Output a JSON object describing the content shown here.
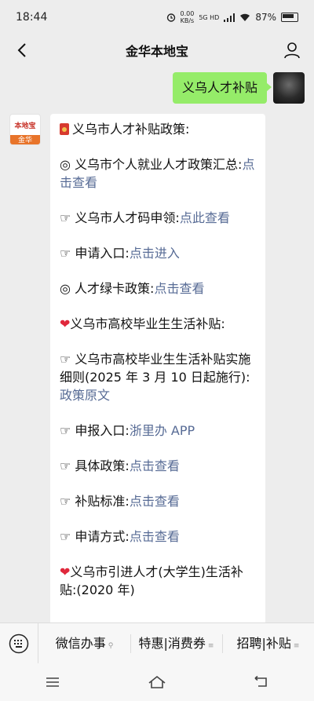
{
  "status_bar": {
    "time": "18:44",
    "net_speed_value": "0.00",
    "net_speed_unit": "KB/s",
    "network": "5G HD",
    "battery": "87%"
  },
  "nav": {
    "title": "金华本地宝"
  },
  "sent_message": {
    "text": "义乌人才补贴"
  },
  "bot": {
    "avatar_logo": "本地宝",
    "avatar_tag": "金华"
  },
  "received_message": {
    "title": "义乌市人才补贴政策:",
    "p1_text": "◎ 义乌市个人就业人才政策汇总:",
    "p1_link": "点击查看",
    "p2_text": "☞ 义乌市人才码申领:",
    "p2_link": "点此查看",
    "p3_text": "☞ 申请入口:",
    "p3_link": "点击进入",
    "p4_text": "◎ 人才绿卡政策:",
    "p4_link": "点击查看",
    "section2_title": "义乌市高校毕业生生活补贴:",
    "p5_text": "☞ 义乌市高校毕业生生活补贴实施细则(2025 年 3 月 10 日起施行):",
    "p5_link": "政策原文",
    "p6_text": "☞ 申报入口:",
    "p6_link": "浙里办 APP",
    "p7_text": "☞ 具体政策:",
    "p7_link": "点击查看",
    "p8_text": "☞ 补贴标准:",
    "p8_link": "点击查看",
    "p9_text": "☞ 申请方式:",
    "p9_link": "点击查看",
    "section3_title": "义乌市引进人才(大学生)生活补贴:(2020 年)"
  },
  "bottom_menu": {
    "item1": "微信办事",
    "item2": "特惠|消费券",
    "item3": "招聘|补贴"
  }
}
